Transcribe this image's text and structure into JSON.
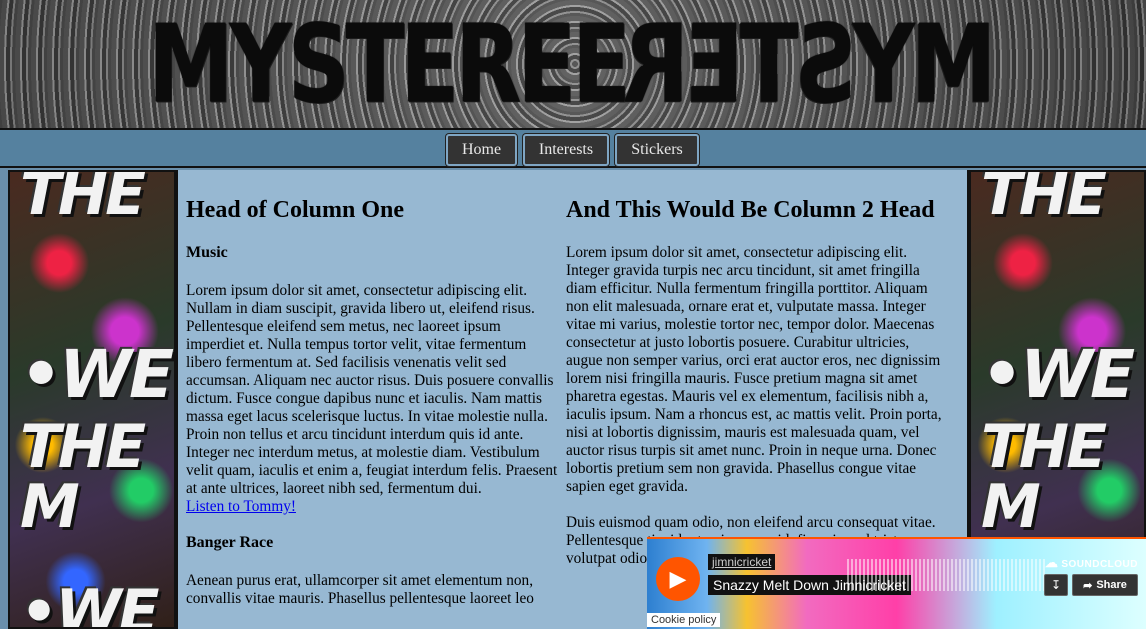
{
  "banner": {
    "logo_left": "MYSTER",
    "logo_mid": "EE",
    "logo_right": "MYSTER"
  },
  "nav": {
    "items": [
      {
        "label": "Home"
      },
      {
        "label": "Interests"
      },
      {
        "label": "Stickers"
      }
    ]
  },
  "side": {
    "graffiti_top": "THE",
    "graffiti_we": "•WE",
    "graffiti_them": "THE M",
    "graffiti_bottom": "•WE"
  },
  "column1": {
    "heading": "Head of Column One",
    "section1_heading": "Music",
    "section1_text": "Lorem ipsum dolor sit amet, consectetur adipiscing elit. Nullam in diam suscipit, gravida libero ut, eleifend risus. Pellentesque eleifend sem metus, nec laoreet ipsum imperdiet et. Nulla tempus tortor velit, vitae fermentum libero fermentum at. Sed facilisis venenatis velit sed accumsan. Aliquam nec auctor risus. Duis posuere convallis dictum. Fusce congue dapibus nunc et iaculis. Nam mattis massa eget lacus scelerisque luctus. In vitae molestie nulla. Proin non tellus et arcu tincidunt interdum quis id ante. Integer nec interdum metus, at molestie diam. Vestibulum velit quam, iaculis et enim a, feugiat interdum felis. Praesent at ante ultrices, laoreet nibh sed, fermentum dui.",
    "section1_link": "Listen to Tommy!",
    "section2_heading": "Banger Race",
    "section2_text": "Aenean purus erat, ullamcorper sit amet elementum non, convallis vitae mauris. Phasellus pellentesque laoreet leo"
  },
  "column2": {
    "heading": "And This Would Be Column 2 Head",
    "para1": "Lorem ipsum dolor sit amet, consectetur adipiscing elit. Integer gravida turpis nec arcu tincidunt, sit amet fringilla diam efficitur. Nulla fermentum fringilla porttitor. Aliquam non elit malesuada, ornare erat et, vulputate massa. Integer vitae mi varius, molestie tortor nec, tempor dolor. Maecenas consectetur at justo lobortis posuere. Curabitur ultricies, augue non semper varius, orci erat auctor eros, nec dignissim lorem nisi fringilla mauris. Fusce pretium magna sit amet pharetra egestas. Mauris vel ex elementum, facilisis nibh a, iaculis ipsum. Nam a rhoncus est, ac mattis velit. Proin porta, nisi at lobortis dignissim, mauris est malesuada quam, vel auctor risus turpis sit amet nunc. Proin in neque urna. Donec lobortis pretium sem non gravida. Phasellus congue vitae sapien eget gravida.",
    "para2": "Duis euismod quam odio, non eleifend arcu consequat vitae. Pellentesque tincidunt quis ornare id, fin euismod trist volutpat odio"
  },
  "soundcloud": {
    "user": "jimnicricket",
    "track_title": "Snazzy Melt Down Jimnicricket",
    "brand": "SOUNDCLOUD",
    "share_label": "Share",
    "cookie_label": "Cookie policy",
    "play_icon": "play-icon",
    "accent": "#ff5500"
  },
  "colors": {
    "nav_bg": "#55819f",
    "content_bg": "#97b8d2",
    "button_bg": "#333333",
    "link": "#0000ee"
  }
}
